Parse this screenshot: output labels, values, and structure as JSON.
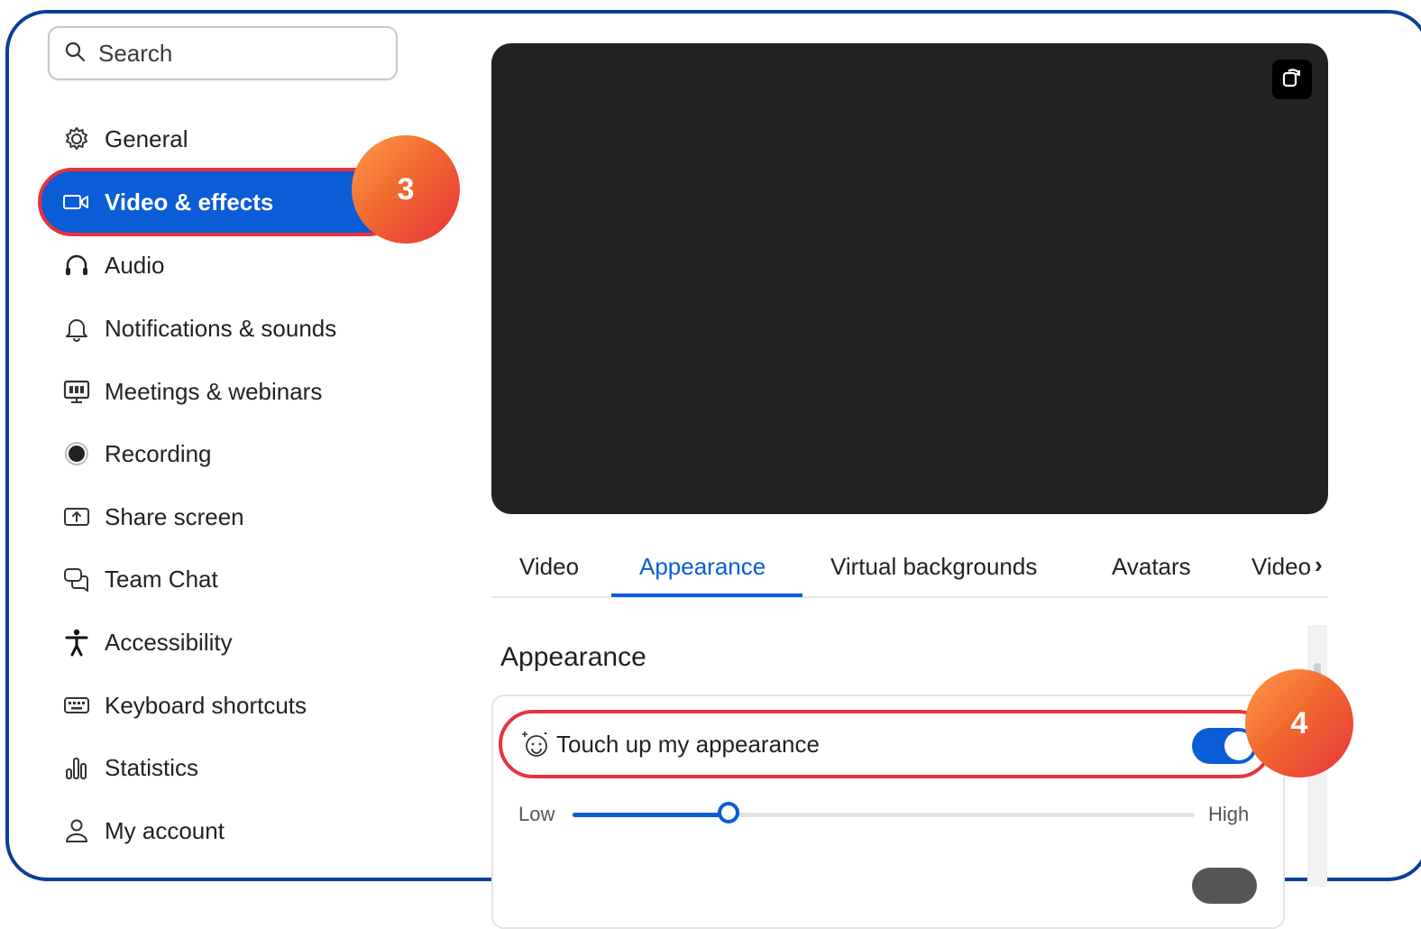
{
  "search": {
    "placeholder": "Search"
  },
  "sidebar": {
    "items": [
      {
        "label": "General",
        "icon": "gear-icon"
      },
      {
        "label": "Video & effects",
        "icon": "video-camera-icon",
        "active": true
      },
      {
        "label": "Audio",
        "icon": "headphones-icon"
      },
      {
        "label": "Notifications & sounds",
        "icon": "bell-icon"
      },
      {
        "label": "Meetings & webinars",
        "icon": "presentation-icon"
      },
      {
        "label": "Recording",
        "icon": "record-icon"
      },
      {
        "label": "Share screen",
        "icon": "share-screen-icon"
      },
      {
        "label": "Team Chat",
        "icon": "chat-bubbles-icon"
      },
      {
        "label": "Accessibility",
        "icon": "accessibility-icon"
      },
      {
        "label": "Keyboard shortcuts",
        "icon": "keyboard-icon"
      },
      {
        "label": "Statistics",
        "icon": "bar-chart-icon"
      },
      {
        "label": "My account",
        "icon": "person-icon"
      }
    ]
  },
  "badges": {
    "step3": "3",
    "step4": "4"
  },
  "tabs": [
    {
      "label": "Video"
    },
    {
      "label": "Appearance",
      "active": true
    },
    {
      "label": "Virtual backgrounds"
    },
    {
      "label": "Avatars"
    },
    {
      "label": "Video"
    }
  ],
  "appearance": {
    "section_title": "Appearance",
    "touch_up_label": "Touch up my appearance",
    "touch_up_enabled": true,
    "slider": {
      "low_label": "Low",
      "high_label": "High",
      "value": 0.25
    }
  },
  "colors": {
    "accent": "#0b5cd7",
    "highlight": "#e8323c",
    "frame": "#0b3f94",
    "preview_bg": "#222222"
  }
}
